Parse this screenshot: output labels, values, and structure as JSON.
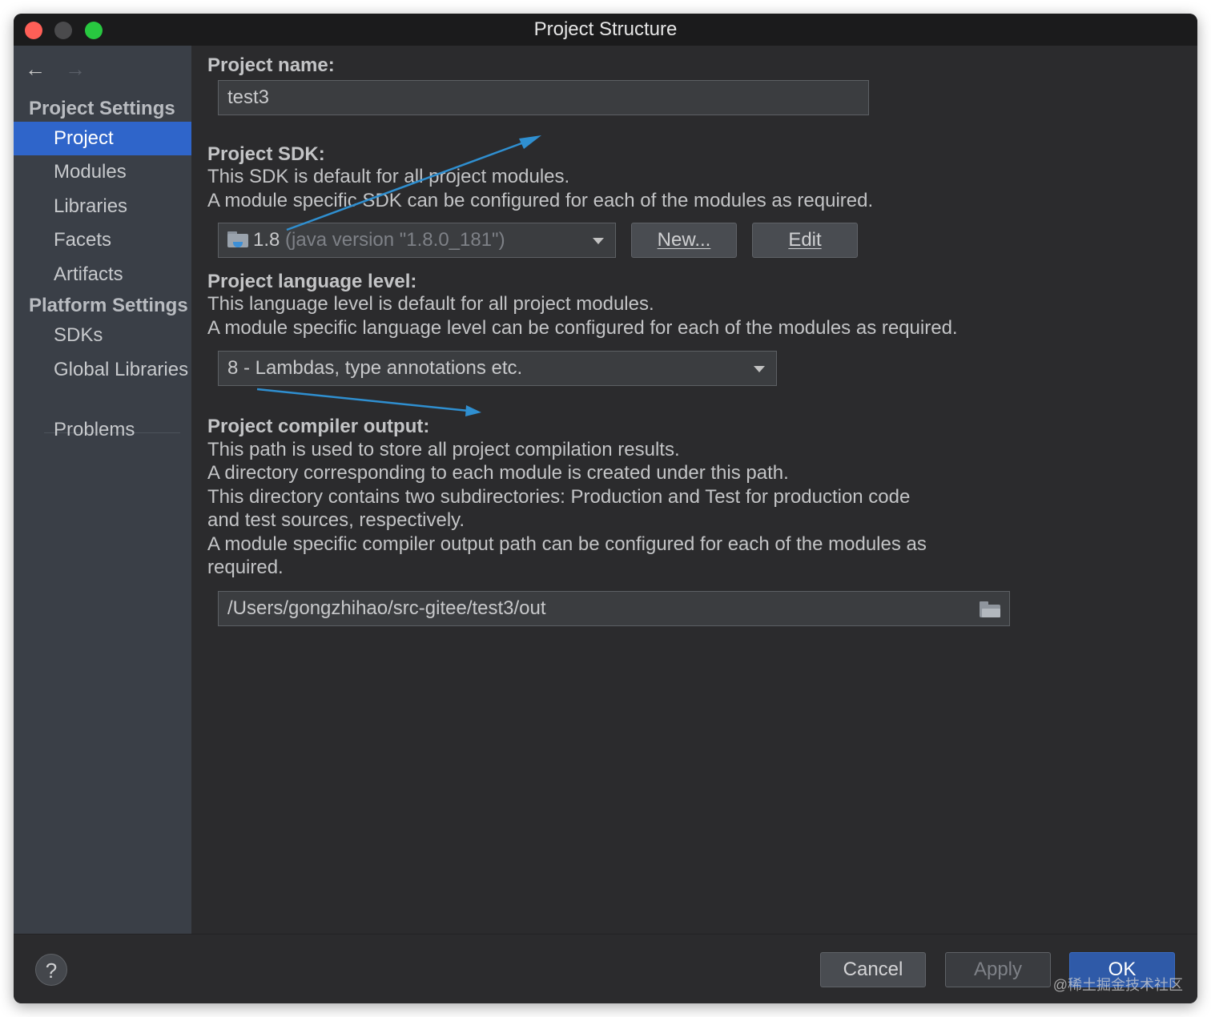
{
  "window": {
    "title": "Project Structure"
  },
  "sidebar": {
    "back_icon": "arrow-left-icon",
    "forward_icon": "arrow-right-icon",
    "project_settings_header": "Project Settings",
    "project_settings_items": [
      "Project",
      "Modules",
      "Libraries",
      "Facets",
      "Artifacts"
    ],
    "selected_item": "Project",
    "platform_settings_header": "Platform Settings",
    "platform_settings_items": [
      "SDKs",
      "Global Libraries"
    ],
    "problems": "Problems"
  },
  "main": {
    "project_name": {
      "label": "Project name:",
      "value": "test3"
    },
    "project_sdk": {
      "label": "Project SDK:",
      "line1": "This SDK is default for all project modules.",
      "line2": "A module specific SDK can be configured for each of the modules as required.",
      "selected_version": "1.8",
      "selected_detail": "(java version \"1.8.0_181\")",
      "new_button": "New...",
      "edit_button": "Edit"
    },
    "language_level": {
      "label": "Project language level:",
      "line1": "This language level is default for all project modules.",
      "line2": "A module specific language level can be configured for each of the modules as required.",
      "selected": "8 - Lambdas, type annotations etc."
    },
    "compiler_output": {
      "label": "Project compiler output:",
      "line1": "This path is used to store all project compilation results.",
      "line2": "A directory corresponding to each module is created under this path.",
      "line3": "This directory contains two subdirectories: Production and Test for production code",
      "line4": "and test sources, respectively.",
      "line5": "A module specific compiler output path can be configured for each of the modules as",
      "line6": "required.",
      "path": "/Users/gongzhihao/src-gitee/test3/out"
    }
  },
  "footer": {
    "help": "?",
    "cancel": "Cancel",
    "apply": "Apply",
    "ok": "OK",
    "watermark": "@稀土掘金技术社区"
  },
  "colors": {
    "selection": "#2f65ca",
    "annotation_arrow": "#2f8fd0",
    "close": "#ff5f57",
    "zoom": "#28c840"
  }
}
